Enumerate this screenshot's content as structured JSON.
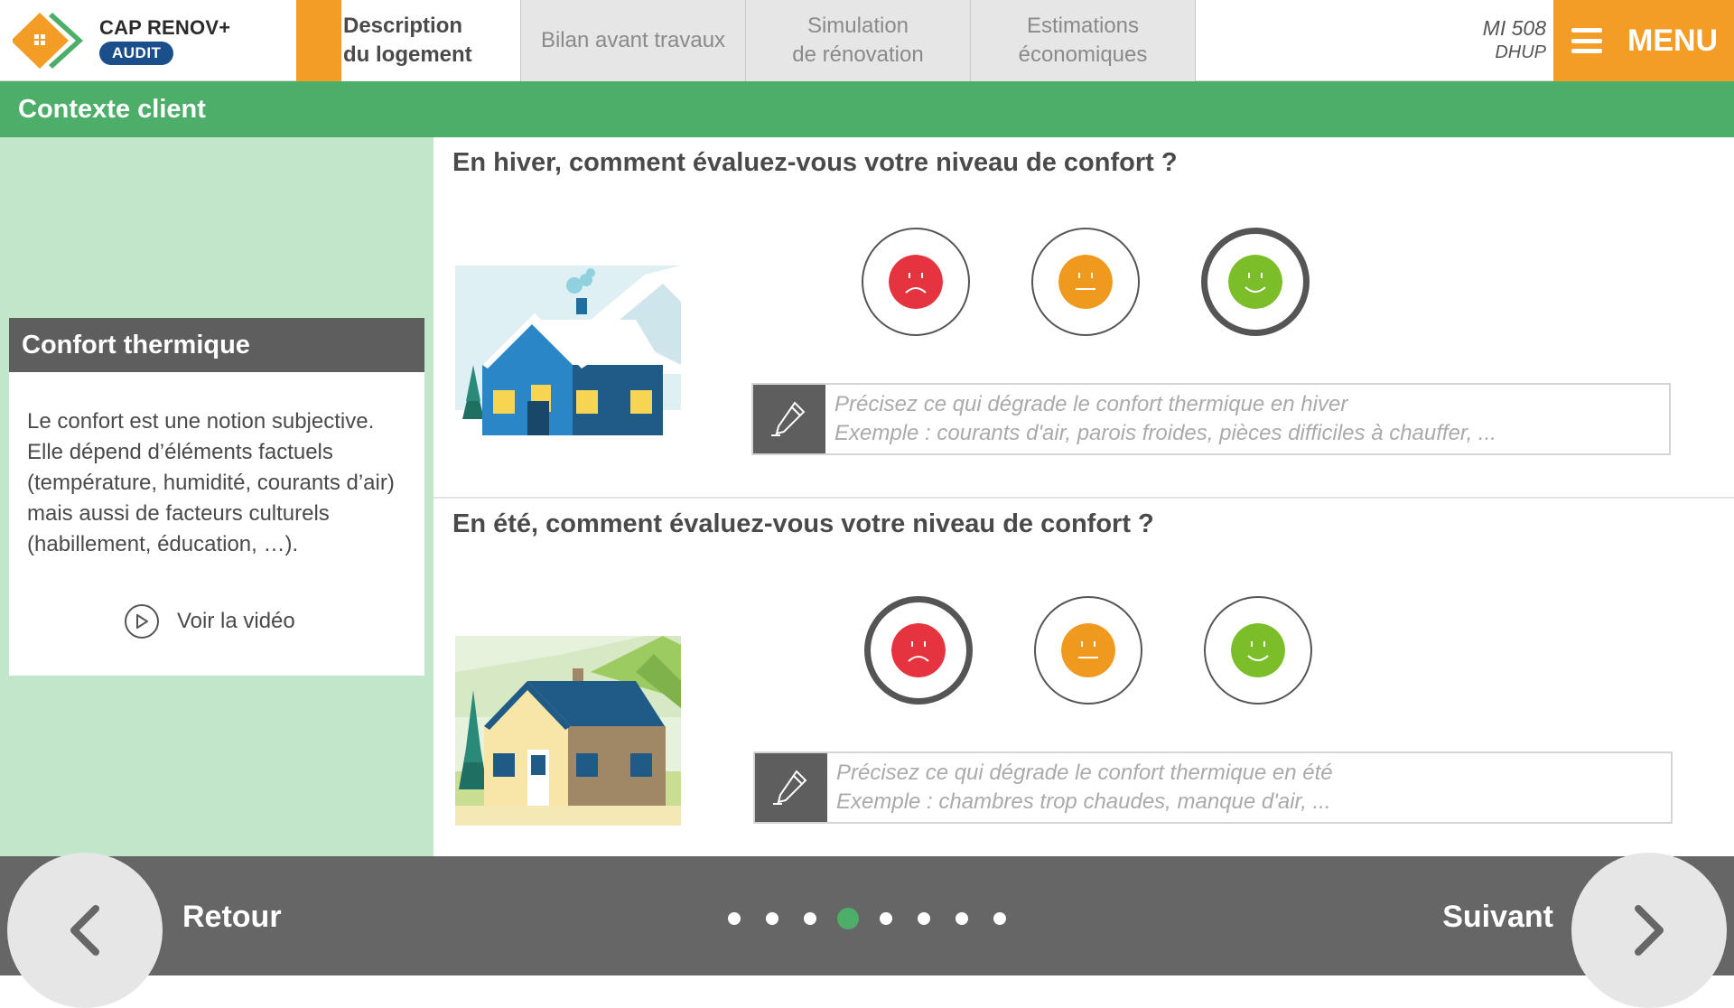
{
  "header": {
    "brand_name": "CAP RENOV+",
    "brand_badge": "AUDIT",
    "tabs": [
      {
        "label": "Description\ndu logement",
        "active": true
      },
      {
        "label": "Bilan avant travaux",
        "active": false
      },
      {
        "label": "Simulation\nde rénovation",
        "active": false
      },
      {
        "label": "Estimations\néconomiques",
        "active": false
      }
    ],
    "doc_id": "MI 508",
    "doc_sub": "DHUP",
    "menu_label": "MENU"
  },
  "section": {
    "title": "Contexte client"
  },
  "sidebar": {
    "card_title": "Confort thermique",
    "card_text": "Le confort est une notion subjective. Elle dépend d’éléments factuels (température, humidité, courants d’air) mais aussi de facteurs culturels (habillement, éducation, …).",
    "video_label": "Voir la vidéo"
  },
  "questions": [
    {
      "title": "En hiver, comment évaluez-vous votre niveau de confort ?",
      "selected": "good",
      "placeholder_line1": "Précisez ce qui dégrade le confort thermique en hiver",
      "placeholder_line2": "Exemple : courants d'air, parois froides, pièces difficiles à chauffer, ..."
    },
    {
      "title": "En été, comment évaluez-vous votre niveau de confort ?",
      "selected": "bad",
      "placeholder_line1": "Précisez ce qui dégrade le confort thermique en été",
      "placeholder_line2": "Exemple : chambres trop chaudes, manque d'air, ..."
    }
  ],
  "ratings": [
    "bad",
    "neutral",
    "good"
  ],
  "colors": {
    "accent_orange": "#f39c26",
    "green": "#4cae68",
    "face_bad": "#e53340",
    "face_neutral": "#ef9a1e",
    "face_good": "#7cbd2a"
  },
  "footer": {
    "back_label": "Retour",
    "next_label": "Suivant",
    "page_count": 8,
    "current_page": 4
  }
}
